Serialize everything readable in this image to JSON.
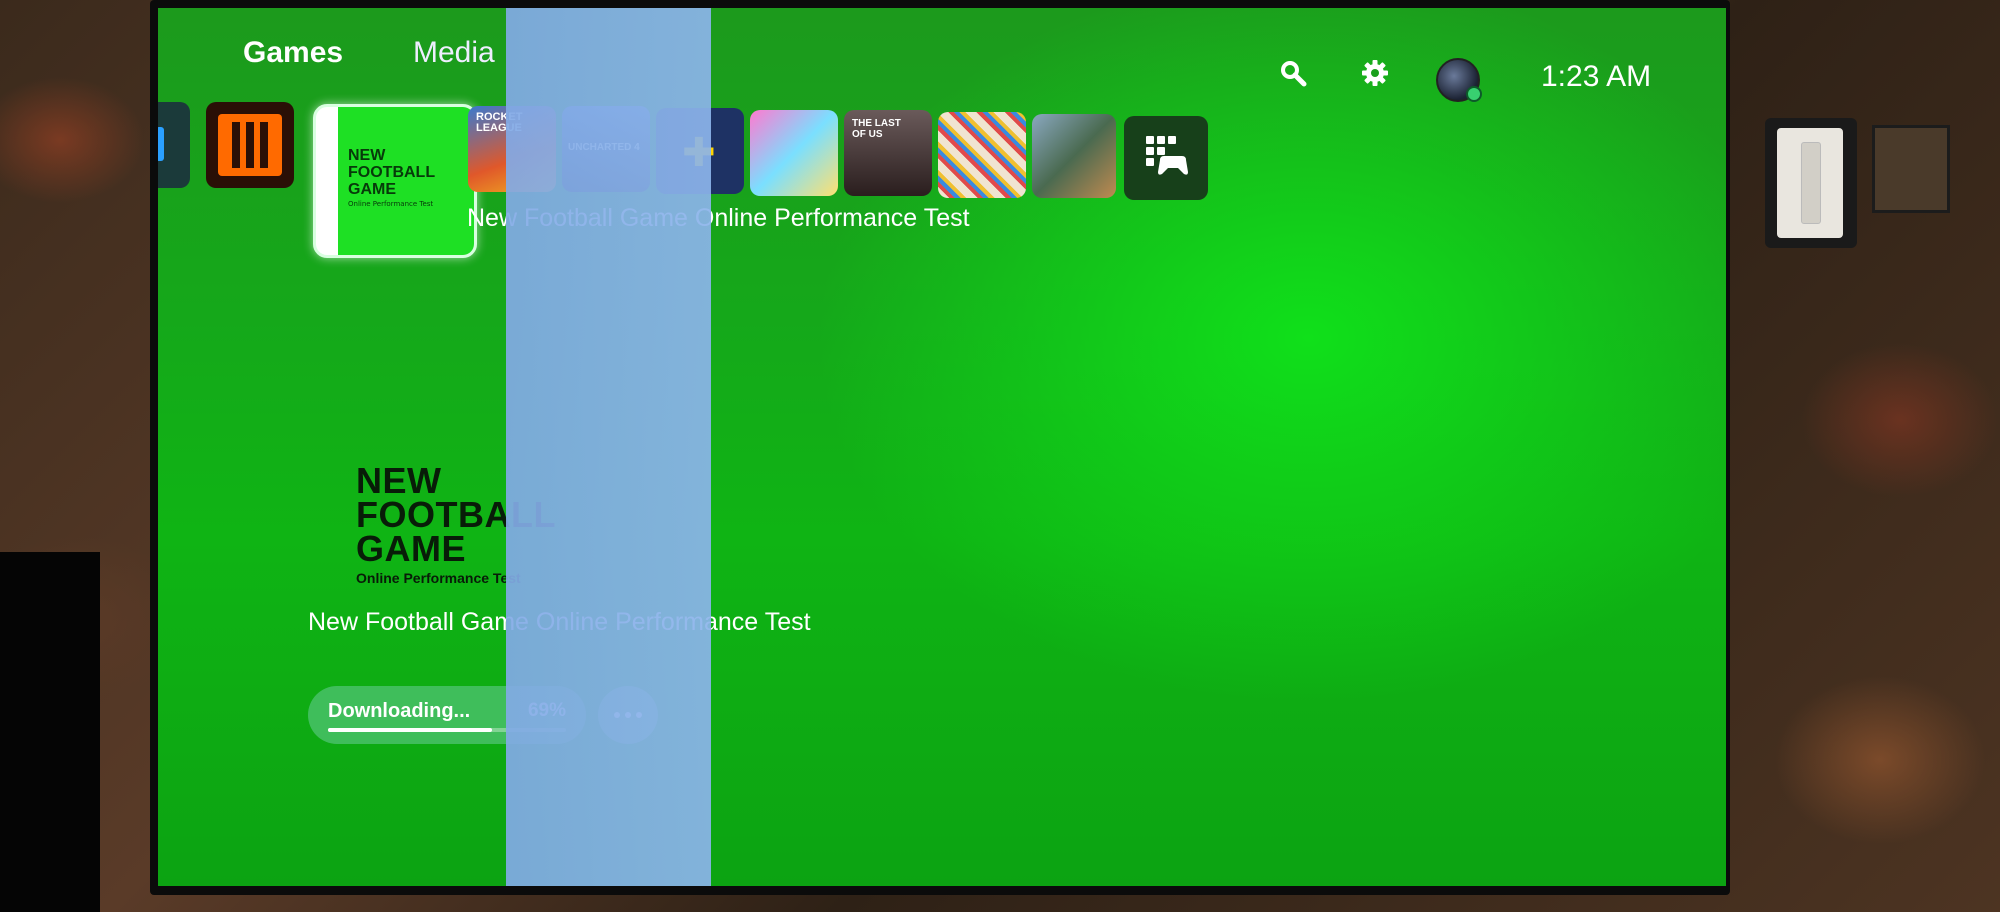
{
  "nav": {
    "tabs": [
      {
        "label": "Games",
        "active": true
      },
      {
        "label": "Media",
        "active": false
      }
    ]
  },
  "status_bar": {
    "icons": [
      "search-icon",
      "gear-icon",
      "avatar"
    ],
    "clock": "1:23 AM"
  },
  "game_row": {
    "focused_label": "New Football Game Online Performance Test",
    "tiles": [
      {
        "name": "partial-tile",
        "color": "#1b3a3a"
      },
      {
        "name": "call-of-duty-black-ops-3",
        "color": "#ff6a00"
      },
      {
        "name": "new-football-game",
        "color": "#1ee024",
        "focused": true,
        "art_text": "NEW FOOTBALL GAME",
        "art_sub": "Online Performance Test"
      },
      {
        "name": "rocket-league",
        "color": "#d84a1a",
        "art_text": "ROCKET LEAGUE"
      },
      {
        "name": "uncharted-4",
        "color": "#2a4a7a",
        "art_text": "UNCHARTED 4"
      },
      {
        "name": "playstation-plus",
        "color": "#1a3070"
      },
      {
        "name": "colorful-game",
        "color": "#ff7ad0"
      },
      {
        "name": "the-last-of-us",
        "color": "#3a2a2a",
        "art_text": "THE LAST OF US"
      },
      {
        "name": "cyberpunk-stickers",
        "color": "#f0e4d0"
      },
      {
        "name": "gta-v",
        "color": "#6a8aa0"
      },
      {
        "name": "game-library",
        "color": "#1f3a1f"
      }
    ]
  },
  "hero": {
    "logo_text": [
      "NEW",
      "FOOTBALL",
      "GAME"
    ],
    "logo_sub": "Online Performance Test",
    "title": "New Football Game Online Performance Test",
    "download": {
      "label": "Downloading...",
      "percent_text": "69%",
      "progress": 0.69
    }
  }
}
